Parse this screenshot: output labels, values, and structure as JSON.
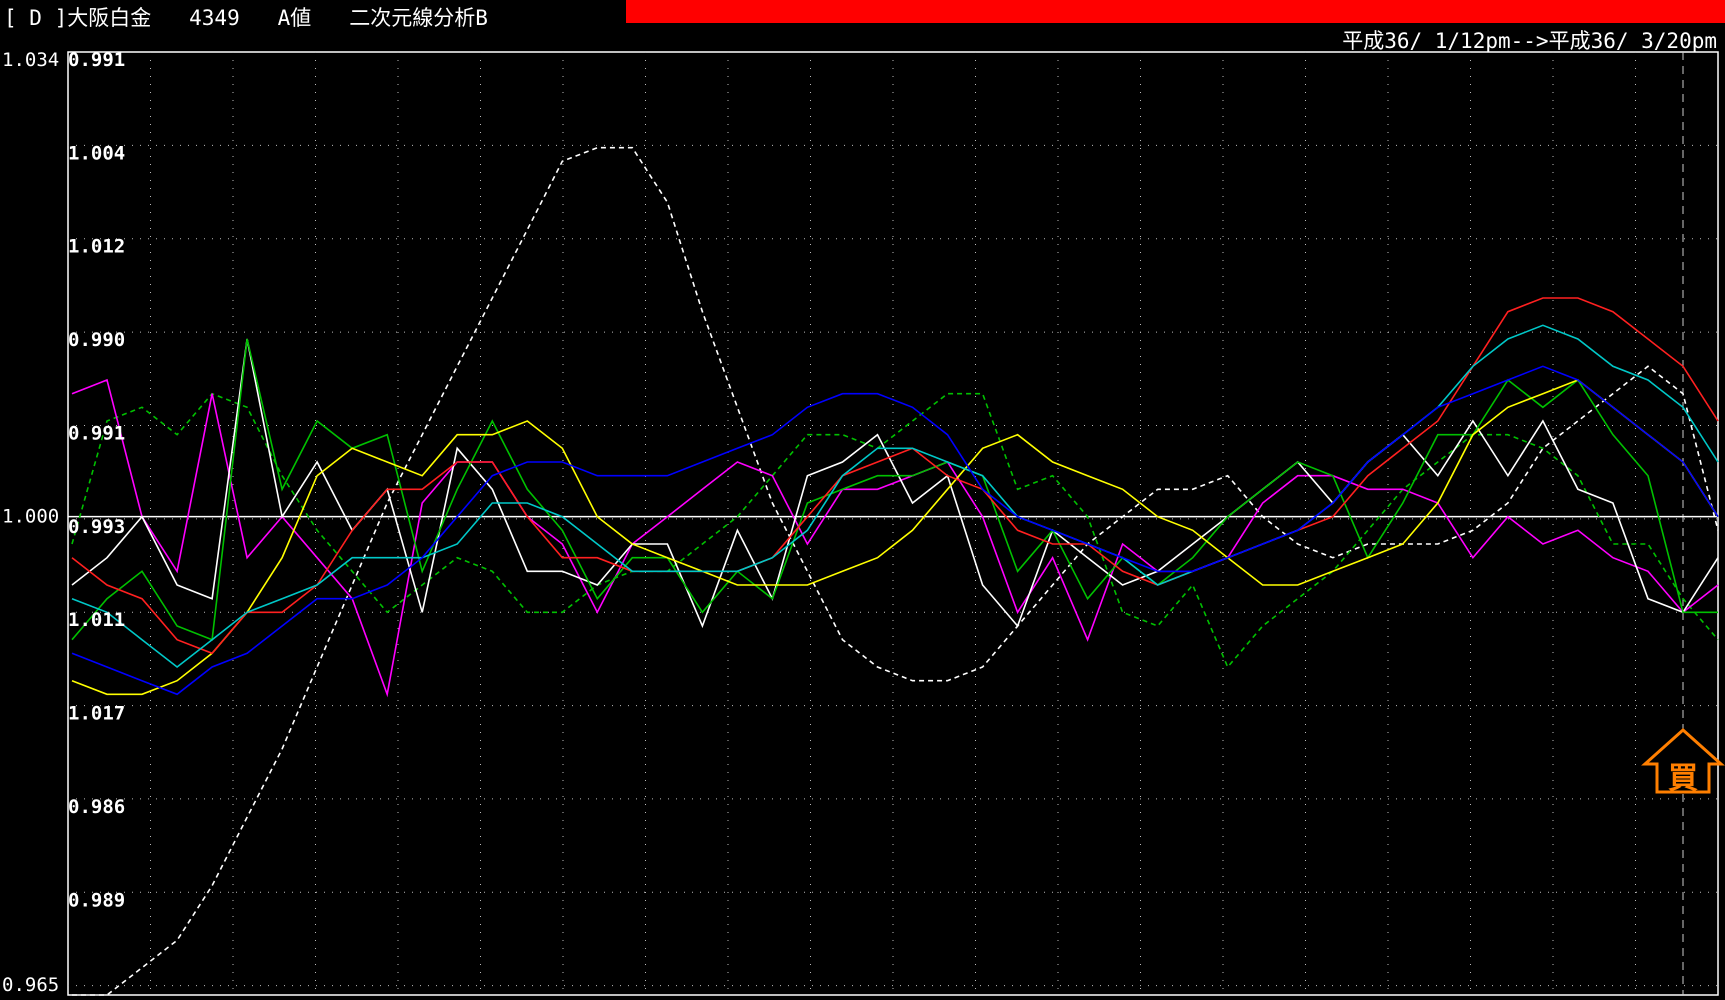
{
  "header": {
    "title": "[ D ]大阪白金   4349   A値   二次元線分析B",
    "date_range": "平成36/ 1/12pm-->平成36/ 3/20pm",
    "bar_color": "#ff0000"
  },
  "signal": {
    "text": "買",
    "color": "#ff7f00",
    "icon": "up-arrow-icon"
  },
  "chart_data": {
    "type": "line",
    "ratio_axis": {
      "ticks": [
        "1.034",
        "1.000",
        "0.965"
      ],
      "min": 0.965,
      "max": 1.034,
      "baseline": 1.0
    },
    "inner_labels": [
      "0.991",
      "1.004",
      "1.012",
      "0.990",
      "0.991",
      "0.993",
      "1.011",
      "1.017",
      "0.986",
      "0.989"
    ],
    "grid": true,
    "x_count": 48,
    "series": [
      {
        "color": "#ffffff",
        "style": "dashed",
        "values": [
          0.965,
          0.965,
          0.967,
          0.969,
          0.973,
          0.978,
          0.983,
          0.989,
          0.995,
          1.001,
          1.006,
          1.011,
          1.016,
          1.021,
          1.026,
          1.027,
          1.027,
          1.023,
          1.015,
          1.008,
          1.001,
          0.996,
          0.991,
          0.989,
          0.988,
          0.988,
          0.989,
          0.992,
          0.995,
          0.998,
          1.0,
          1.002,
          1.002,
          1.003,
          1.0,
          0.998,
          0.997,
          0.998,
          0.998,
          0.998,
          0.999,
          1.001,
          1.005,
          1.007,
          1.009,
          1.011,
          1.009,
          0.999
        ]
      },
      {
        "color": "#00c000",
        "style": "dashed",
        "values": [
          0.998,
          1.007,
          1.008,
          1.006,
          1.009,
          1.008,
          1.003,
          0.999,
          0.996,
          0.993,
          0.995,
          0.997,
          0.996,
          0.993,
          0.993,
          0.995,
          0.996,
          0.996,
          0.998,
          1.0,
          1.003,
          1.006,
          1.006,
          1.005,
          1.007,
          1.009,
          1.009,
          1.002,
          1.003,
          1.0,
          0.993,
          0.992,
          0.995,
          0.989,
          0.992,
          0.994,
          0.996,
          0.999,
          1.002,
          1.004,
          1.006,
          1.006,
          1.005,
          1.003,
          0.998,
          0.998,
          0.994,
          0.991
        ]
      },
      {
        "color": "#ff00ff",
        "style": "solid",
        "values": [
          1.009,
          1.01,
          1.0,
          0.996,
          1.009,
          0.997,
          1.0,
          0.997,
          0.994,
          0.987,
          1.001,
          1.004,
          1.004,
          1.0,
          0.998,
          0.993,
          0.998,
          1.0,
          1.002,
          1.004,
          1.003,
          0.998,
          1.002,
          1.002,
          1.003,
          1.004,
          1.0,
          0.993,
          0.997,
          0.991,
          0.998,
          0.996,
          0.996,
          0.997,
          1.001,
          1.003,
          1.003,
          1.002,
          1.002,
          1.001,
          0.997,
          1.0,
          0.998,
          0.999,
          0.997,
          0.996,
          0.993,
          0.995
        ]
      },
      {
        "color": "#ffffff",
        "style": "solid",
        "values": [
          0.995,
          0.997,
          1.0,
          0.995,
          0.994,
          1.013,
          1.0,
          1.004,
          0.999,
          1.002,
          0.993,
          1.005,
          1.002,
          0.996,
          0.996,
          0.995,
          0.998,
          0.998,
          0.992,
          0.999,
          0.994,
          1.003,
          1.004,
          1.006,
          1.001,
          1.003,
          0.995,
          0.992,
          0.999,
          0.997,
          0.995,
          0.996,
          0.998,
          1.0,
          1.002,
          1.004,
          1.001,
          1.004,
          1.006,
          1.003,
          1.007,
          1.003,
          1.007,
          1.002,
          1.001,
          0.994,
          0.993,
          0.997
        ]
      },
      {
        "color": "#00c000",
        "style": "solid",
        "values": [
          0.991,
          0.994,
          0.996,
          0.992,
          0.991,
          1.013,
          1.002,
          1.007,
          1.005,
          1.006,
          0.996,
          1.002,
          1.007,
          1.002,
          0.999,
          0.994,
          0.997,
          0.997,
          0.993,
          0.996,
          0.994,
          1.001,
          1.002,
          1.003,
          1.003,
          1.004,
          1.003,
          0.996,
          0.999,
          0.994,
          0.997,
          0.995,
          0.997,
          1.0,
          1.002,
          1.004,
          1.003,
          0.997,
          1.001,
          1.006,
          1.006,
          1.01,
          1.008,
          1.01,
          1.006,
          1.003,
          0.993,
          0.993
        ]
      },
      {
        "color": "#ffff00",
        "style": "solid",
        "values": [
          0.988,
          0.987,
          0.987,
          0.988,
          0.99,
          0.993,
          0.997,
          1.003,
          1.005,
          1.004,
          1.003,
          1.006,
          1.006,
          1.007,
          1.005,
          1.0,
          0.998,
          0.997,
          0.996,
          0.995,
          0.995,
          0.995,
          0.996,
          0.997,
          0.999,
          1.002,
          1.005,
          1.006,
          1.004,
          1.003,
          1.002,
          1.0,
          0.999,
          0.997,
          0.995,
          0.995,
          0.996,
          0.997,
          0.998,
          1.001,
          1.006,
          1.008,
          1.009,
          1.01,
          1.008,
          1.006,
          1.004,
          1.0
        ]
      },
      {
        "color": "#ff2020",
        "style": "solid",
        "values": [
          0.997,
          0.995,
          0.994,
          0.991,
          0.99,
          0.993,
          0.993,
          0.995,
          0.999,
          1.002,
          1.002,
          1.004,
          1.004,
          1.0,
          0.997,
          0.997,
          0.996,
          0.996,
          0.996,
          0.996,
          0.997,
          1.0,
          1.003,
          1.004,
          1.005,
          1.003,
          1.002,
          0.999,
          0.998,
          0.998,
          0.996,
          0.995,
          0.996,
          0.997,
          0.998,
          0.999,
          1.0,
          1.003,
          1.005,
          1.007,
          1.011,
          1.015,
          1.016,
          1.016,
          1.015,
          1.013,
          1.011,
          1.007
        ]
      },
      {
        "color": "#00c8c8",
        "style": "solid",
        "values": [
          0.994,
          0.993,
          0.991,
          0.989,
          0.991,
          0.993,
          0.994,
          0.995,
          0.997,
          0.997,
          0.997,
          0.998,
          1.001,
          1.001,
          1.0,
          0.998,
          0.996,
          0.996,
          0.996,
          0.996,
          0.997,
          0.999,
          1.003,
          1.005,
          1.005,
          1.004,
          1.003,
          1.0,
          0.999,
          0.998,
          0.997,
          0.995,
          0.996,
          0.997,
          0.998,
          0.999,
          1.001,
          1.004,
          1.006,
          1.008,
          1.011,
          1.013,
          1.014,
          1.013,
          1.011,
          1.01,
          1.008,
          1.004
        ]
      },
      {
        "color": "#0000ff",
        "style": "solid",
        "values": [
          0.99,
          0.989,
          0.988,
          0.987,
          0.989,
          0.99,
          0.992,
          0.994,
          0.994,
          0.995,
          0.997,
          1.0,
          1.003,
          1.004,
          1.004,
          1.003,
          1.003,
          1.003,
          1.004,
          1.005,
          1.006,
          1.008,
          1.009,
          1.009,
          1.008,
          1.006,
          1.002,
          1.0,
          0.999,
          0.998,
          0.997,
          0.996,
          0.996,
          0.997,
          0.998,
          0.999,
          1.001,
          1.004,
          1.006,
          1.008,
          1.009,
          1.01,
          1.011,
          1.01,
          1.008,
          1.006,
          1.004,
          1.0
        ]
      }
    ]
  }
}
